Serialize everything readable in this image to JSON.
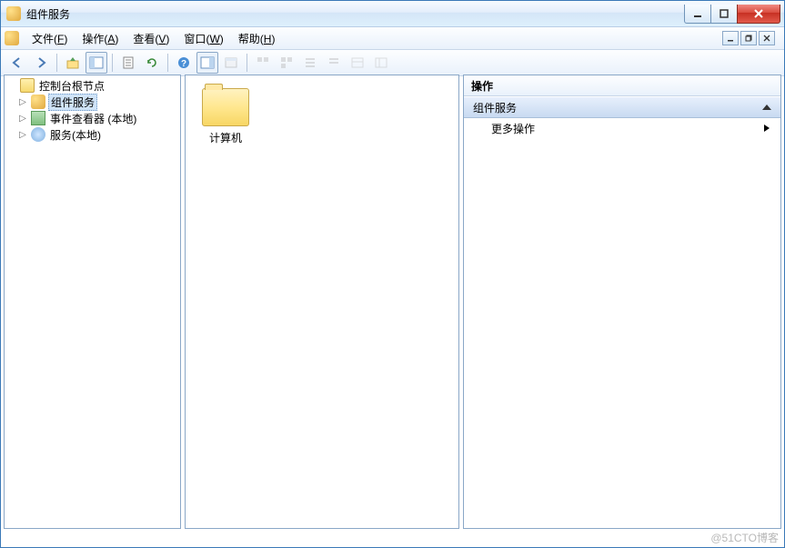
{
  "window": {
    "title": "组件服务"
  },
  "menu": {
    "file": {
      "label": "文件",
      "key": "F"
    },
    "action": {
      "label": "操作",
      "key": "A"
    },
    "view": {
      "label": "查看",
      "key": "V"
    },
    "window": {
      "label": "窗口",
      "key": "W"
    },
    "help": {
      "label": "帮助",
      "key": "H"
    }
  },
  "toolbar_icons": {
    "back": "back-arrow",
    "forward": "forward-arrow",
    "up": "up-level",
    "props": "properties",
    "refresh": "refresh",
    "export": "export-list",
    "help": "help",
    "showhide": "show-hide-tree",
    "app": "application",
    "g1": "grid1",
    "g2": "grid2",
    "g3": "grid3",
    "g4": "grid4",
    "g5": "grid5",
    "g6": "grid6"
  },
  "tree": {
    "root": {
      "label": "控制台根节点"
    },
    "items": [
      {
        "label": "组件服务",
        "icon": "comp",
        "selected": true
      },
      {
        "label": "事件查看器 (本地)",
        "icon": "event"
      },
      {
        "label": "服务(本地)",
        "icon": "svc"
      }
    ]
  },
  "content": {
    "items": [
      {
        "label": "计算机"
      }
    ]
  },
  "actions": {
    "header": "操作",
    "section": "组件服务",
    "more": "更多操作"
  },
  "watermark": "@51CTO博客"
}
